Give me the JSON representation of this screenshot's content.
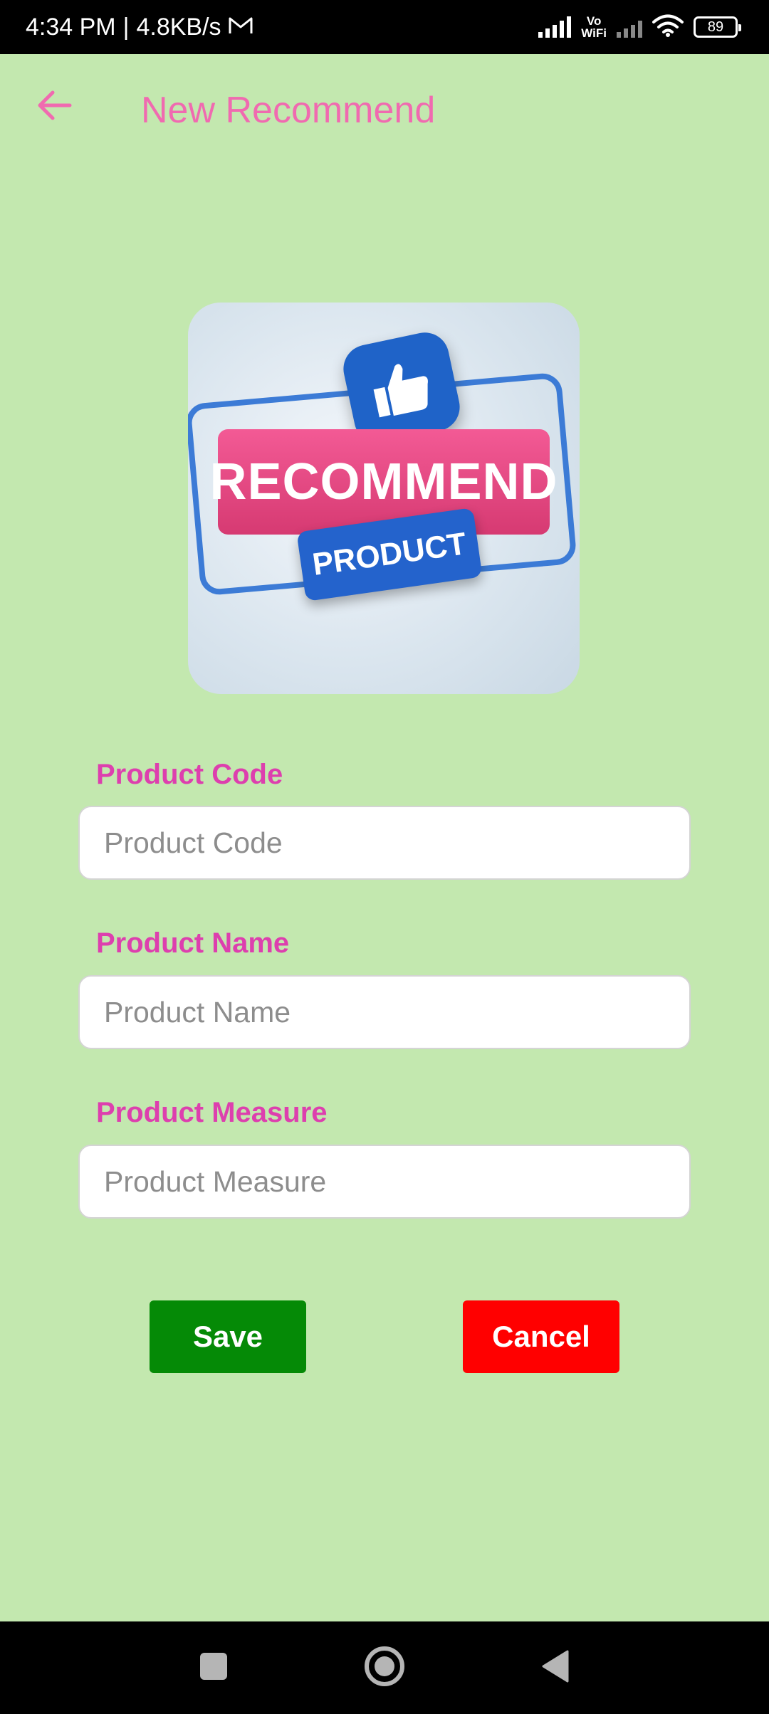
{
  "status_bar": {
    "time": "4:34 PM",
    "speed": "4.8KB/s",
    "vowifi_top": "Vo",
    "vowifi_bottom": "WiFi",
    "battery": "89"
  },
  "header": {
    "title": "New Recommend"
  },
  "hero": {
    "banner_main": "RECOMMEND",
    "banner_sub": "PRODUCT"
  },
  "form": {
    "product_code": {
      "label": "Product Code",
      "placeholder": "Product Code",
      "value": ""
    },
    "product_name": {
      "label": "Product Name",
      "placeholder": "Product Name",
      "value": ""
    },
    "product_measure": {
      "label": "Product Measure",
      "placeholder": "Product Measure",
      "value": ""
    }
  },
  "actions": {
    "save_label": "Save",
    "cancel_label": "Cancel"
  },
  "colors": {
    "background": "#c3e8af",
    "accent_pink": "#f06ab0",
    "label_pink": "#dd3fae",
    "save_green": "#058a06",
    "cancel_red": "#ff0000"
  },
  "icons": {
    "back": "arrow-left-icon",
    "gmail": "mail-icon",
    "signal": "signal-icon",
    "wifi": "wifi-icon",
    "battery": "battery-icon",
    "nav_recents": "square-icon",
    "nav_home": "circle-icon",
    "nav_back": "triangle-back-icon"
  }
}
